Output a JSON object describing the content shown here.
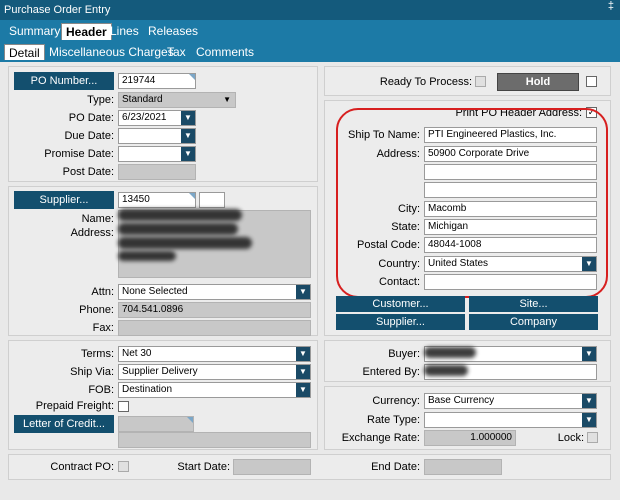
{
  "window": {
    "title": "Purchase Order Entry",
    "pin": "‡"
  },
  "tabs": [
    "Summary",
    "Header",
    "Lines",
    "Releases"
  ],
  "subtabs": [
    "Detail",
    "Miscellaneous Charges",
    "Tax",
    "Comments"
  ],
  "po": {
    "number_btn": "PO Number...",
    "number": "219744",
    "type_label": "Type:",
    "type": "Standard",
    "po_date_label": "PO Date:",
    "po_date": "6/23/2021",
    "due_date_label": "Due Date:",
    "promise_date_label": "Promise Date:",
    "post_date_label": "Post Date:"
  },
  "supplier": {
    "btn": "Supplier...",
    "code": "13450",
    "name_label": "Name:",
    "address_label": "Address:",
    "attn_label": "Attn:",
    "attn": "None Selected",
    "phone_label": "Phone:",
    "phone": "704.541.0896",
    "fax_label": "Fax:"
  },
  "status": {
    "ready_label": "Ready To Process:",
    "hold": "Hold",
    "print_label": "Print PO Header Address:"
  },
  "shipto": {
    "name_label": "Ship To Name:",
    "name": "PTI Engineered Plastics, Inc.",
    "address_label": "Address:",
    "address1": "50900 Corporate Drive",
    "city_label": "City:",
    "city": "Macomb",
    "state_label": "State:",
    "state": "Michigan",
    "postal_label": "Postal Code:",
    "postal": "48044-1008",
    "country_label": "Country:",
    "country": "United States",
    "contact_label": "Contact:"
  },
  "addr_buttons": {
    "customer": "Customer...",
    "site": "Site...",
    "supplier": "Supplier...",
    "company": "Company"
  },
  "terms": {
    "terms_label": "Terms:",
    "terms": "Net 30",
    "shipvia_label": "Ship Via:",
    "shipvia": "Supplier Delivery",
    "fob_label": "FOB:",
    "fob": "Destination",
    "prepaid_label": "Prepaid Freight:",
    "letter_btn": "Letter of Credit..."
  },
  "buyer": {
    "buyer_label": "Buyer:",
    "entered_label": "Entered By:"
  },
  "currency": {
    "currency_label": "Currency:",
    "currency": "Base Currency",
    "rate_type_label": "Rate Type:",
    "exchange_label": "Exchange Rate:",
    "exchange": "1.000000",
    "lock_label": "Lock:"
  },
  "contract": {
    "contract_label": "Contract PO:",
    "start_label": "Start Date:",
    "end_label": "End Date:"
  },
  "colors": {
    "titlebar": "#145a7c",
    "tabbar": "#1c7aa6",
    "button": "#134f6e",
    "annotation": "#d71f1f"
  }
}
